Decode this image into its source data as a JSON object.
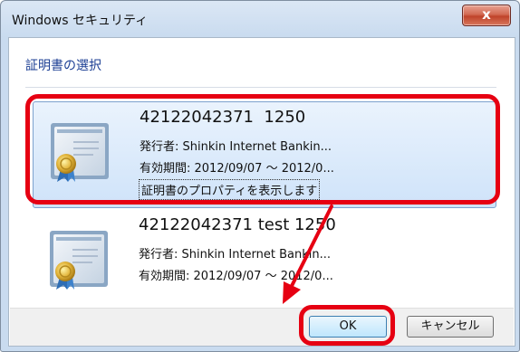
{
  "window": {
    "title": "Windows セキュリティ",
    "close_label": "x"
  },
  "dialog": {
    "heading": "証明書の選択"
  },
  "certificates": [
    {
      "title": "42122042371  1250",
      "issuer": "発行者: Shinkin Internet Bankin...",
      "validity": "有効期間: 2012/09/07 ～ 2012/0...",
      "properties_link": "証明書のプロパティを表示します",
      "selected": true
    },
    {
      "title": "42122042371 test 1250",
      "issuer": "発行者: Shinkin Internet Bankin...",
      "validity": "有効期間: 2012/09/07 ～ 2012/0...",
      "selected": false
    }
  ],
  "buttons": {
    "ok": "OK",
    "cancel": "キャンセル"
  },
  "annotation": {
    "highlight_color": "#e60012"
  },
  "icons": {
    "certificate": "certificate-icon",
    "close": "close-icon"
  }
}
